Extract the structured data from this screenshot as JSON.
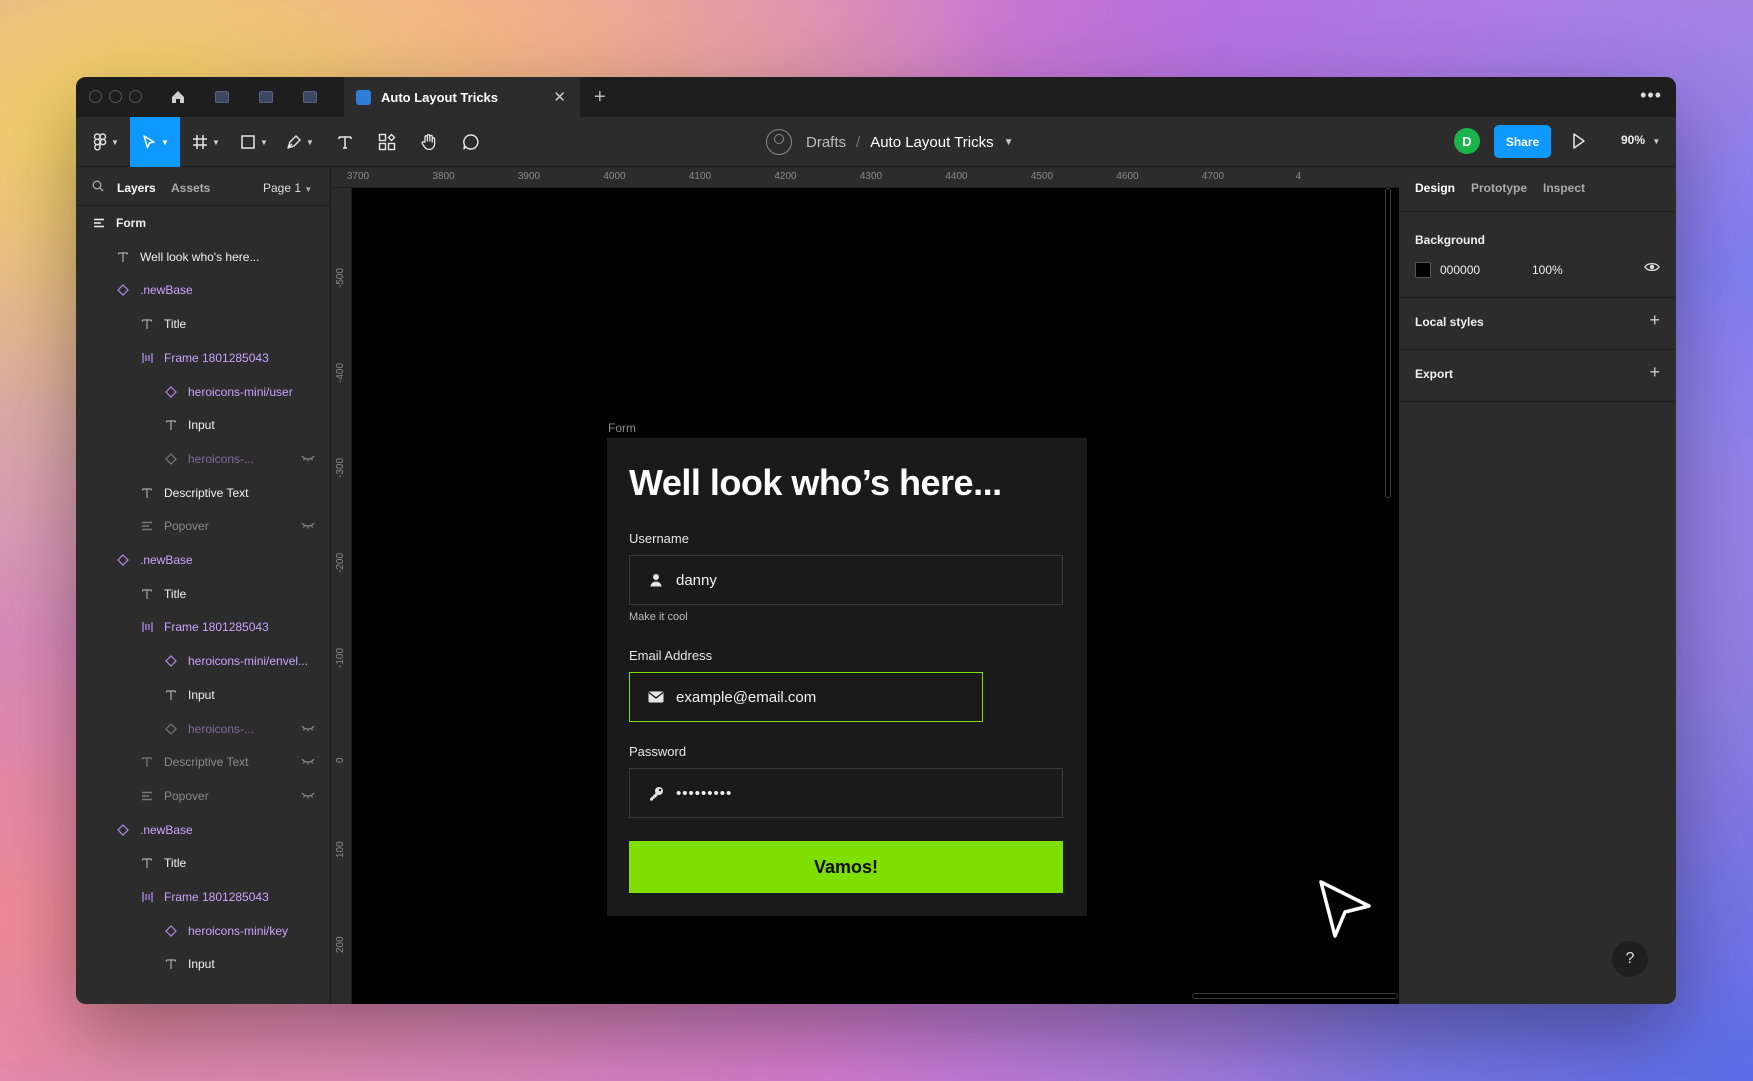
{
  "window": {
    "tab_title": "Auto Layout Tricks",
    "close_glyph": "✕",
    "new_tab_glyph": "+",
    "more_glyph": "•••"
  },
  "toolbar": {
    "breadcrumb_drafts": "Drafts",
    "breadcrumb_sep": "/",
    "breadcrumb_file": "Auto Layout Tricks",
    "user_initial": "D",
    "share_label": "Share",
    "zoom_level": "90%",
    "accent_color": "#0d99ff"
  },
  "left_panel": {
    "tab_layers": "Layers",
    "tab_assets": "Assets",
    "page_label": "Page 1",
    "layers": [
      {
        "label": "Form",
        "kind": "frame",
        "indent": 0,
        "dim": false,
        "hidden": false
      },
      {
        "label": "Well look who's here...",
        "kind": "text",
        "indent": 1,
        "dim": false,
        "hidden": false
      },
      {
        "label": ".newBase",
        "kind": "component",
        "indent": 1,
        "dim": false,
        "hidden": false
      },
      {
        "label": "Title",
        "kind": "text",
        "indent": 2,
        "dim": false,
        "hidden": false
      },
      {
        "label": "Frame 1801285043",
        "kind": "autolayout",
        "indent": 2,
        "dim": false,
        "hidden": false
      },
      {
        "label": "heroicons-mini/user",
        "kind": "component",
        "indent": 3,
        "dim": false,
        "hidden": false
      },
      {
        "label": "Input",
        "kind": "text",
        "indent": 3,
        "dim": false,
        "hidden": false
      },
      {
        "label": "heroicons-...",
        "kind": "component",
        "indent": 3,
        "dim": true,
        "hidden": true
      },
      {
        "label": "Descriptive Text",
        "kind": "text",
        "indent": 2,
        "dim": false,
        "hidden": false
      },
      {
        "label": "Popover",
        "kind": "frame",
        "indent": 2,
        "dim": true,
        "hidden": true
      },
      {
        "label": ".newBase",
        "kind": "component",
        "indent": 1,
        "dim": false,
        "hidden": false
      },
      {
        "label": "Title",
        "kind": "text",
        "indent": 2,
        "dim": false,
        "hidden": false
      },
      {
        "label": "Frame 1801285043",
        "kind": "autolayout",
        "indent": 2,
        "dim": false,
        "hidden": false
      },
      {
        "label": "heroicons-mini/envel...",
        "kind": "component",
        "indent": 3,
        "dim": false,
        "hidden": false
      },
      {
        "label": "Input",
        "kind": "text",
        "indent": 3,
        "dim": false,
        "hidden": false
      },
      {
        "label": "heroicons-...",
        "kind": "component",
        "indent": 3,
        "dim": true,
        "hidden": true
      },
      {
        "label": "Descriptive Text",
        "kind": "text",
        "indent": 2,
        "dim": true,
        "hidden": true
      },
      {
        "label": "Popover",
        "kind": "frame",
        "indent": 2,
        "dim": true,
        "hidden": true
      },
      {
        "label": ".newBase",
        "kind": "component",
        "indent": 1,
        "dim": false,
        "hidden": false
      },
      {
        "label": "Title",
        "kind": "text",
        "indent": 2,
        "dim": false,
        "hidden": false
      },
      {
        "label": "Frame 1801285043",
        "kind": "autolayout",
        "indent": 2,
        "dim": false,
        "hidden": false
      },
      {
        "label": "heroicons-mini/key",
        "kind": "component",
        "indent": 3,
        "dim": false,
        "hidden": false
      },
      {
        "label": "Input",
        "kind": "text",
        "indent": 3,
        "dim": false,
        "hidden": false
      }
    ]
  },
  "canvas": {
    "ruler_x": [
      "3700",
      "3800",
      "3900",
      "4000",
      "4100",
      "4200",
      "4300",
      "4400",
      "4500",
      "4600",
      "4700",
      "4"
    ],
    "ruler_y": [
      "-500",
      "-400",
      "-300",
      "-200",
      "-100",
      "0",
      "100",
      "200"
    ],
    "frame_label": "Form",
    "form": {
      "title": "Well look who’s here...",
      "username_label": "Username",
      "username_value": "danny",
      "username_help": "Make it cool",
      "email_label": "Email Address",
      "email_value": "example@email.com",
      "password_label": "Password",
      "password_value": "•••••••••",
      "submit_label": "Vamos!",
      "accent_color": "#7fe000"
    }
  },
  "right_panel": {
    "tab_design": "Design",
    "tab_prototype": "Prototype",
    "tab_inspect": "Inspect",
    "background_title": "Background",
    "background_hex": "000000",
    "background_opacity": "100%",
    "local_styles_title": "Local styles",
    "export_title": "Export",
    "add_glyph": "+"
  },
  "help_glyph": "?"
}
